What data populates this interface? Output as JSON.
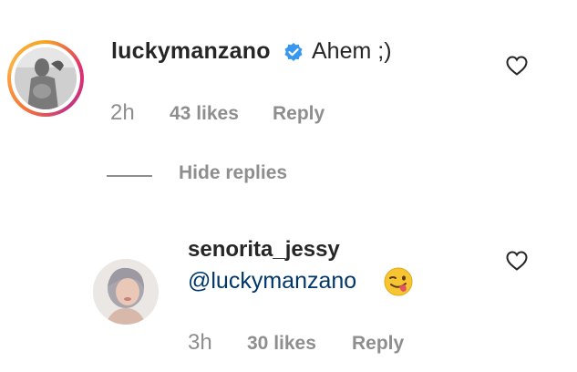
{
  "comment": {
    "username": "luckymanzano",
    "verified_icon": "verified-badge-icon",
    "text": "Ahem ;)",
    "time": "2h",
    "likes": "43 likes",
    "reply_label": "Reply",
    "heart_icon": "heart-outline-icon"
  },
  "replies_toggle": {
    "label": "Hide replies"
  },
  "reply": {
    "username": "senorita_jessy",
    "mention": "@luckymanzano",
    "emoji_icon": "winking-face-with-tongue-icon",
    "time": "3h",
    "likes": "30 likes",
    "reply_label": "Reply",
    "heart_icon": "heart-outline-icon"
  },
  "colors": {
    "text_primary": "#262626",
    "text_secondary": "#8e8e8e",
    "mention": "#00376b",
    "verified": "#3897f0",
    "story_ring_start": "#f5a623",
    "story_ring_end": "#c13584"
  }
}
